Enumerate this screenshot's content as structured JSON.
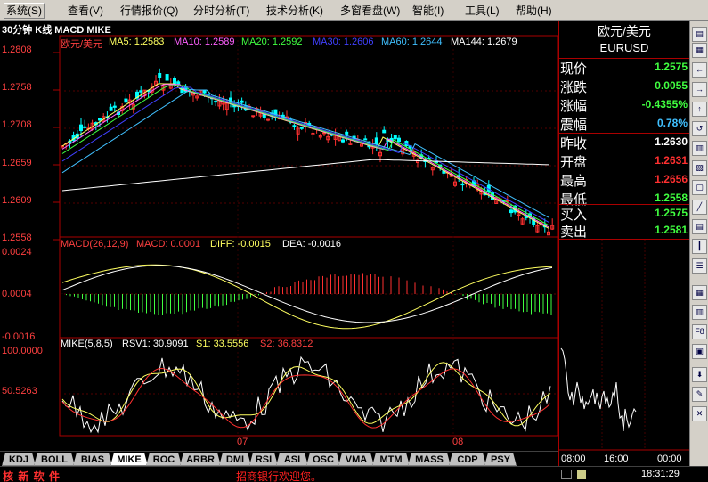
{
  "menu": [
    "系统(S)",
    "查看(V)",
    "行情报价(Q)",
    "分时分析(T)",
    "技术分析(K)",
    "多窗看盘(W)",
    "智能(I)",
    "工具(L)",
    "帮助(H)"
  ],
  "chart_title": "30分钟 K线 MACD MIKE",
  "ma_header": {
    "symbol": "欧元/美元",
    "items": [
      {
        "label": "MA5: 1.2583",
        "color": "#ffff60"
      },
      {
        "label": "MA10: 1.2589",
        "color": "#ff60ff"
      },
      {
        "label": "MA20: 1.2592",
        "color": "#40ff40"
      },
      {
        "label": "MA30: 1.2606",
        "color": "#4040ff"
      },
      {
        "label": "MA60: 1.2644",
        "color": "#40c0ff"
      },
      {
        "label": "MA144: 1.2679",
        "color": "#ffffff"
      }
    ]
  },
  "price_axis": [
    "1.2808",
    "1.2758",
    "1.2708",
    "1.2659",
    "1.2609",
    "1.2558"
  ],
  "macd_header": {
    "name": "MACD(26,12,9)",
    "macd": "MACD: 0.0001",
    "diff": "DIFF: -0.0015",
    "dea": "DEA: -0.0016"
  },
  "macd_axis": [
    "0.0024",
    "0.0004",
    "-0.0016"
  ],
  "mike_header": {
    "name": "MIKE(5,8,5)",
    "rsv": "RSV1: 30.9091",
    "s1": "S1: 33.5556",
    "s2": "S2: 36.8312"
  },
  "mike_axis": [
    "100.0000",
    "50.5263"
  ],
  "date_labels": [
    "07",
    "08"
  ],
  "tabs": [
    "KDJ",
    "BOLL",
    "BIAS",
    "MIKE",
    "ROC",
    "ARBR",
    "DMI",
    "RSI",
    "ASI",
    "OSC",
    "VMA",
    "MTM",
    "MASS",
    "CDP",
    "PSY"
  ],
  "active_tab": "MIKE",
  "info": {
    "title": "欧元/美元",
    "code": "EURUSD",
    "rows": [
      {
        "k": "现价",
        "v": "1.2575",
        "color": "#40ff40"
      },
      {
        "k": "涨跌",
        "v": "0.0055",
        "color": "#40ff40"
      },
      {
        "k": "涨幅",
        "v": "-0.4355%",
        "color": "#40ff40"
      },
      {
        "k": "震幅",
        "v": "0.78%",
        "color": "#40c0ff"
      },
      {
        "k": "昨收",
        "v": "1.2630",
        "color": "#ffffff"
      },
      {
        "k": "开盘",
        "v": "1.2631",
        "color": "#ff3030"
      },
      {
        "k": "最高",
        "v": "1.2656",
        "color": "#ff3030"
      },
      {
        "k": "最低",
        "v": "1.2558",
        "color": "#40ff40"
      },
      {
        "k": "买入",
        "v": "1.2575",
        "color": "#40ff40"
      },
      {
        "k": "卖出",
        "v": "1.2581",
        "color": "#40ff40"
      }
    ]
  },
  "mini_labels": [
    "08:00",
    "16:00",
    "00:00"
  ],
  "status": {
    "brand": "核 新 软 件",
    "message": "招商银行欢迎您。",
    "time": "18:31:29"
  }
}
